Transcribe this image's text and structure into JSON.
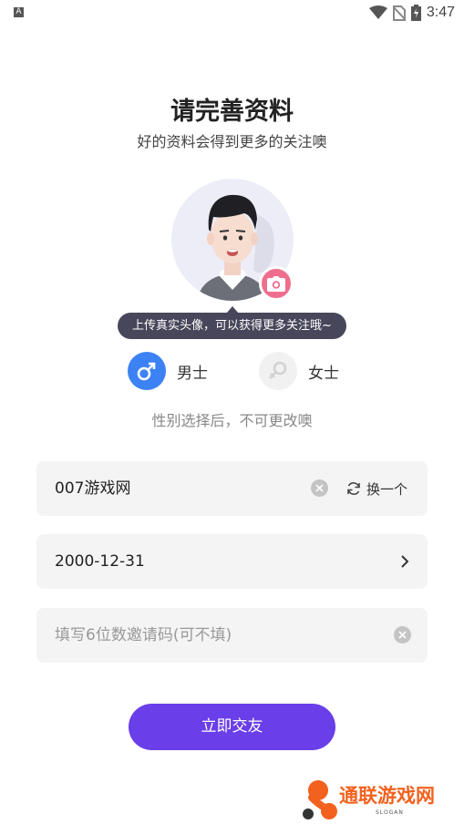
{
  "status_bar": {
    "app_icon_letter": "A",
    "time": "3:47"
  },
  "header": {
    "title": "请完善资料",
    "subtitle": "好的资料会得到更多的关注噢"
  },
  "avatar": {
    "tooltip": "上传真实头像，可以获得更多关注哦~"
  },
  "gender": {
    "male_label": "男士",
    "female_label": "女士",
    "selected": "male",
    "note": "性别选择后，不可更改噢"
  },
  "form": {
    "nickname": {
      "value": "007游戏网",
      "refresh_label": "换一个"
    },
    "birthday": {
      "value": "2000-12-31"
    },
    "invite_code": {
      "placeholder": "填写6位数邀请码(可不填)"
    }
  },
  "submit_label": "立即交友",
  "watermark": {
    "text": "通联游戏网",
    "slogan": "SLOGAN"
  },
  "colors": {
    "primary": "#6a3ee8",
    "male_blue": "#3d82f5",
    "camera_pink": "#ef6e8e",
    "tooltip_bg": "#48465a"
  }
}
